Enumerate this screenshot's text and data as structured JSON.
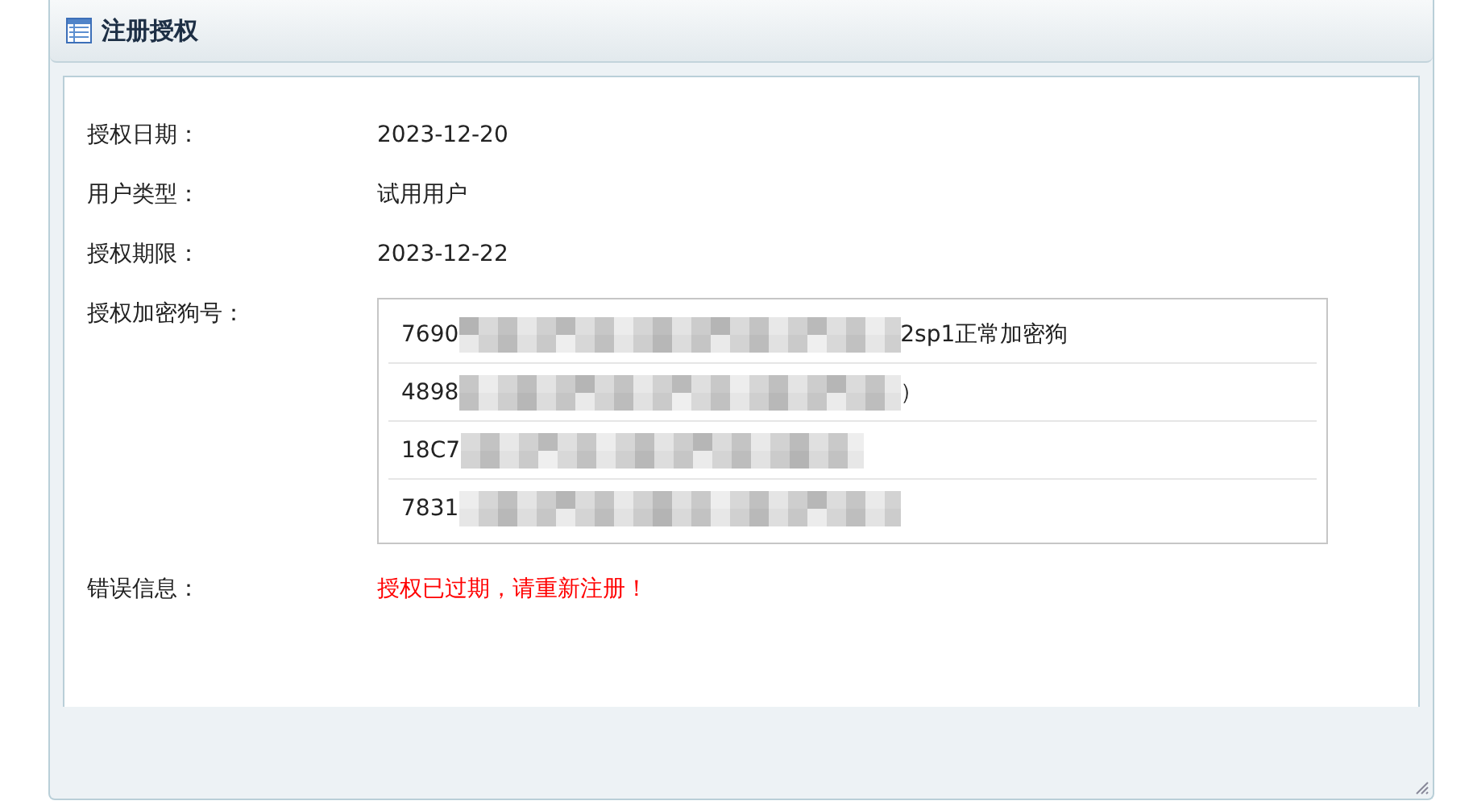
{
  "window": {
    "title": "注册授权"
  },
  "fields": [
    {
      "label": "授权日期：",
      "value": "2023-12-20"
    },
    {
      "label": "用户类型：",
      "value": "试用用户"
    },
    {
      "label": "授权期限：",
      "value": "2023-12-22"
    }
  ],
  "dongle": {
    "label": "授权加密狗号：",
    "rows": [
      {
        "prefix": "7690",
        "redacted": true,
        "suffix": "2sp1正常加密狗"
      },
      {
        "prefix": "4898",
        "redacted": true,
        "suffix": "）"
      },
      {
        "prefix": "18C7",
        "redacted": true
      },
      {
        "prefix": "7831",
        "redacted": true
      }
    ]
  },
  "error": {
    "label": "错误信息：",
    "message": "授权已过期，请重新注册！"
  }
}
